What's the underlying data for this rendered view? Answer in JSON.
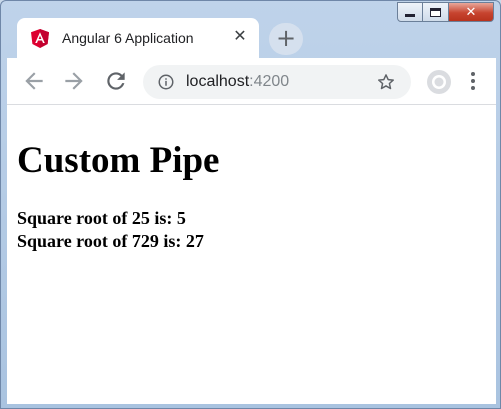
{
  "window": {
    "controls": {
      "minimize": "minimize",
      "maximize": "maximize",
      "close": "close"
    }
  },
  "tab": {
    "title": "Angular 6 Application",
    "favicon": "angular-logo-icon",
    "close_glyph": "✕",
    "new_tab_glyph": "+"
  },
  "toolbar": {
    "back_icon": "arrow-left-icon",
    "forward_icon": "arrow-right-icon",
    "reload_icon": "reload-icon",
    "url_host": "localhost",
    "url_port": ":4200",
    "bookmark_icon": "star-icon",
    "profile_icon": "avatar-icon",
    "menu_icon": "kebab-menu-icon"
  },
  "page": {
    "heading": "Custom Pipe",
    "results": [
      "Square root of 25 is: 5",
      "Square root of 729 is: 27"
    ]
  },
  "colors": {
    "angular_red": "#dd0031",
    "frame_blue": "#bfd3ea",
    "close_red": "#c7442f"
  }
}
